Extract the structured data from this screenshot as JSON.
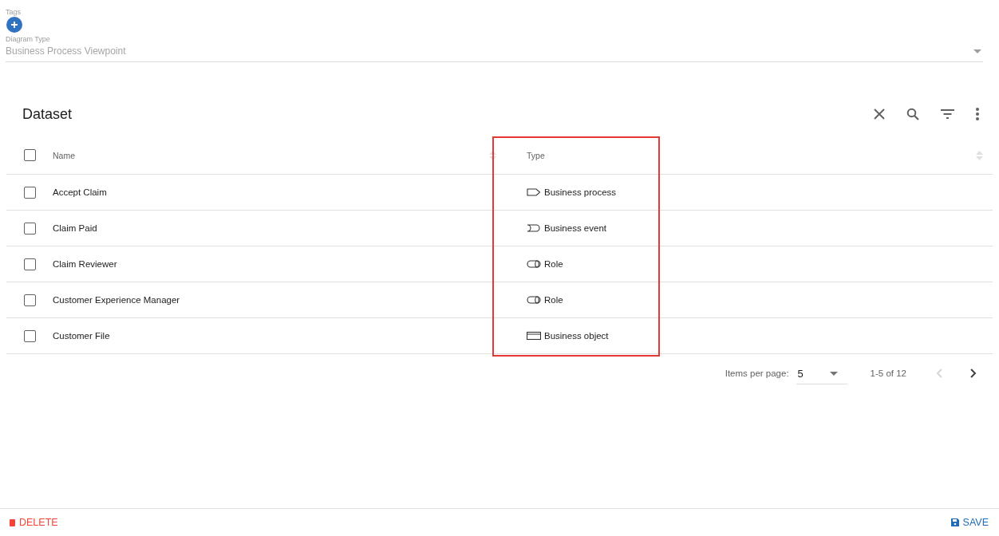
{
  "tags": {
    "label": "Tags"
  },
  "diagram_type": {
    "label": "Diagram Type",
    "value": "Business Process Viewpoint"
  },
  "dataset": {
    "title": "Dataset",
    "columns": [
      {
        "label": "Name"
      },
      {
        "label": "Type"
      }
    ],
    "header_checked": false,
    "rows": [
      {
        "name": "Accept Claim",
        "type": "Business process",
        "kind": "process",
        "checked": false
      },
      {
        "name": "Claim Paid",
        "type": "Business event",
        "kind": "event",
        "checked": false
      },
      {
        "name": "Claim Reviewer",
        "type": "Role",
        "kind": "role",
        "checked": false
      },
      {
        "name": "Customer Experience Manager",
        "type": "Role",
        "kind": "role",
        "checked": false
      },
      {
        "name": "Customer File",
        "type": "Business object",
        "kind": "object",
        "checked": false
      }
    ],
    "pagination": {
      "items_label": "Items per page:",
      "page_size": "5",
      "range": "1-5 of 12",
      "prev_disabled": true,
      "next_disabled": false
    }
  },
  "footer": {
    "delete": "DELETE",
    "save": "SAVE"
  }
}
